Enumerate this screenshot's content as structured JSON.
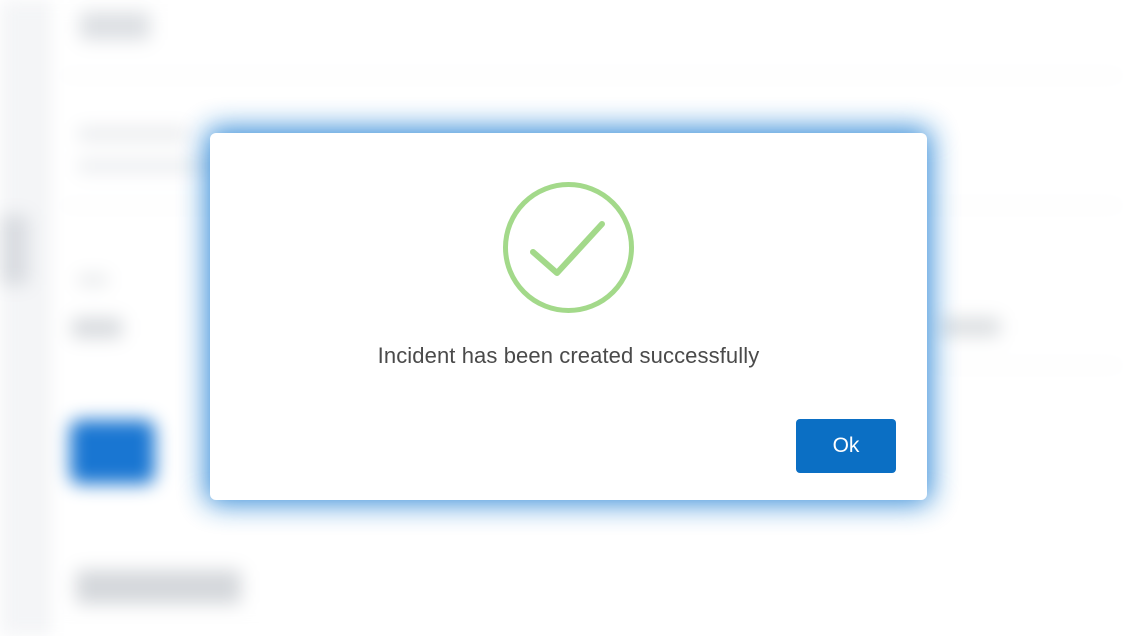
{
  "dialog": {
    "icon": "check-circle-icon",
    "message": "Incident has been created successfully",
    "ok_label": "Ok"
  },
  "colors": {
    "primary": "#0b6fc4",
    "success": "#a3d98a",
    "modal_glow": "#2a86d6",
    "message_text": "#4a4a4a"
  }
}
